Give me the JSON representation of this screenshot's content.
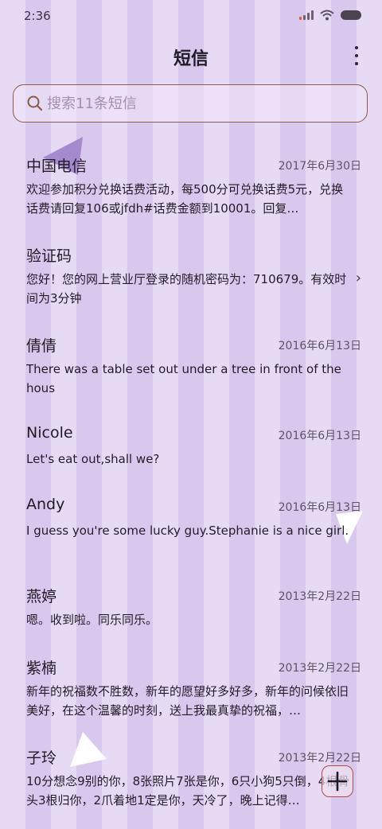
{
  "status_bar": {
    "time": "2:36"
  },
  "header": {
    "title": "短信"
  },
  "search": {
    "placeholder": "搜索11条短信",
    "value": ""
  },
  "messages": [
    {
      "sender": "中国电信",
      "date": "2017年6月30日",
      "preview": "欢迎参加积分兑换话费活动，每500分可兑换话费5元，兑换话费请回复106或jfdh#话费金额到10001。回复…"
    },
    {
      "sender": "验证码",
      "date": "",
      "preview": "您好！您的网上营业厅登录的随机密码为：710679。有效时间为3分钟"
    },
    {
      "sender": "倩倩",
      "date": "2016年6月13日",
      "preview": "There was a table set out under a tree in front of the hous"
    },
    {
      "sender": "Nicole",
      "date": "2016年6月13日",
      "preview": "Let's eat out,shall we?"
    },
    {
      "sender": "Andy",
      "date": "2016年6月13日",
      "preview": "I guess you're some lucky guy.Stephanie is a nice girl."
    },
    {
      "sender": "燕婷",
      "date": "2013年2月22日",
      "preview": "嗯。收到啦。同乐同乐。"
    },
    {
      "sender": "紫楠",
      "date": "2013年2月22日",
      "preview": "新年的祝福数不胜数，新年的愿望好多好多，新年的问候依旧美好，在这个温馨的时刻，送上我最真挚的祝福，…"
    },
    {
      "sender": "子玲",
      "date": "2013年2月22日",
      "preview": "10分想念9别的你，8张照片7张是你，6只小狗5只倒，4根骨头3根归你，2爪着地1定是你，天冷了，晚上记得…"
    }
  ],
  "icons": {
    "search": "search-icon",
    "more": "more-vertical-icon",
    "chevron": "chevron-right-icon",
    "fab": "plus-icon"
  },
  "colors": {
    "background_light": "#e6daf5",
    "background_dark": "#d9c8ee",
    "search_border": "#8a5a4a",
    "fab_border": "#b04a4a"
  }
}
